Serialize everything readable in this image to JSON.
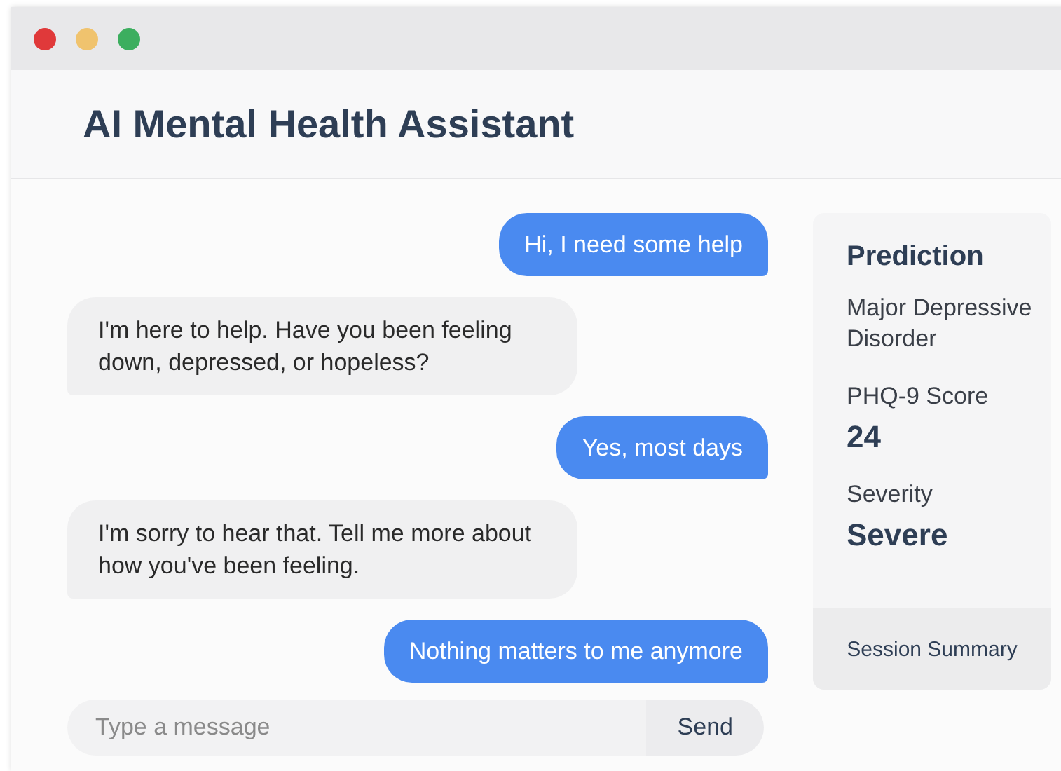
{
  "window": {
    "title": "AI Mental Health Assistant"
  },
  "messages": [
    {
      "kind": "outgoing",
      "text": "Hi, I need some help"
    },
    {
      "kind": "incoming",
      "text": "I'm here to help. Have you been feeling down, depressed, or hopeless?"
    },
    {
      "kind": "outgoing",
      "text": "Yes, most days"
    },
    {
      "kind": "incoming",
      "text": "I'm sorry to hear that. Tell me more about how you've been feeling."
    },
    {
      "kind": "outgoing",
      "text": "Nothing matters to me anymore"
    }
  ],
  "composer": {
    "placeholder": "Type a message",
    "send_button": "Send"
  },
  "prediction_panel": {
    "title": "Prediction",
    "diagnosis": "Major Depressive Disorder",
    "score_label": "PHQ-9 Score",
    "score": "24",
    "severity_label": "Severity",
    "severity": "Severe",
    "footer_button": "Session Summary"
  }
}
